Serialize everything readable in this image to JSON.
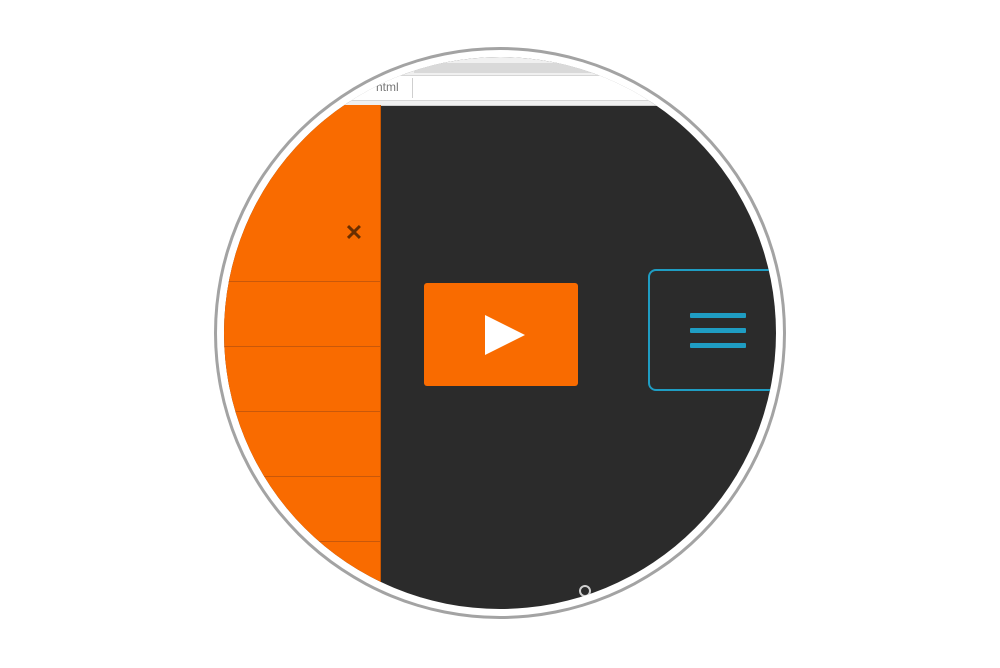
{
  "browser": {
    "address_text": "html"
  },
  "sidebar": {
    "close_icon": "close-icon",
    "items": [
      {
        "label": ""
      },
      {
        "label": ""
      },
      {
        "label": ""
      },
      {
        "label": ""
      },
      {
        "label": ""
      }
    ]
  },
  "main": {
    "play_icon": "play-icon",
    "menu_icon": "hamburger-menu-icon"
  },
  "colors": {
    "accent_orange": "#f96b00",
    "background_dark": "#2b2b2b",
    "menu_blue": "#1f9dc3",
    "close_x": "#6a2e00"
  }
}
